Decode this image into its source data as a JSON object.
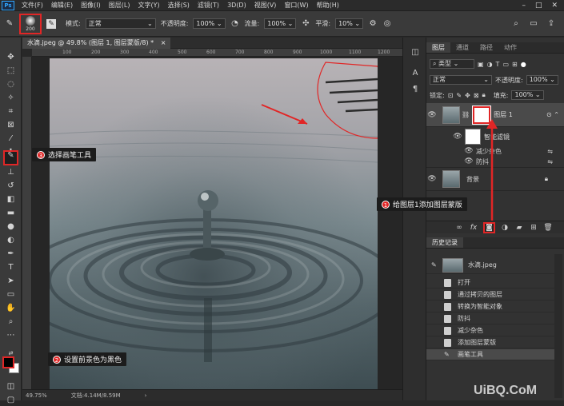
{
  "app": {
    "logo": "Ps",
    "menu": [
      "文件(F)",
      "编辑(E)",
      "图像(I)",
      "图层(L)",
      "文字(Y)",
      "选择(S)",
      "滤镜(T)",
      "3D(D)",
      "视图(V)",
      "窗口(W)",
      "帮助(H)"
    ],
    "window_controls": [
      "–",
      "□",
      "✕"
    ]
  },
  "options": {
    "brush_size": "200",
    "mode_label": "模式:",
    "mode_value": "正常",
    "opacity_label": "不透明度:",
    "opacity_value": "100%",
    "flow_label": "流量:",
    "flow_value": "100%",
    "smooth_label": "平滑:",
    "smooth_value": "10%"
  },
  "document": {
    "tab_title": "水滴.jpeg @ 49.8% (图层 1, 图层蒙版/8) *",
    "tab_close": "×",
    "ruler_ticks": [
      "100",
      "200",
      "300",
      "400",
      "500",
      "600",
      "700",
      "800",
      "900",
      "1000",
      "1100",
      "1200"
    ]
  },
  "status": {
    "zoom": "49.75%",
    "doc_size": "文档:4.14M/8.59M"
  },
  "layers_panel": {
    "tabs": [
      "图层",
      "通道",
      "路径",
      "动作"
    ],
    "filter_kind": "类型",
    "blend_mode": "正常",
    "opacity_label": "不透明度:",
    "opacity_value": "100%",
    "lock_label": "锁定:",
    "fill_label": "填充:",
    "fill_value": "100%",
    "layer1_name": "图层 1",
    "smart_filter_label": "智能滤镜",
    "filter1": "减少杂色",
    "filter2": "防抖",
    "background_name": "背景"
  },
  "history_panel": {
    "tab": "历史记录",
    "snapshot": "水滴.jpeg",
    "items": [
      "打开",
      "通过拷贝的图层",
      "转换为智能对象",
      "防抖",
      "减少杂色",
      "添加图层蒙版",
      "画笔工具"
    ]
  },
  "annotations": {
    "a1_num": "1",
    "a1_text": "给图层1添加图层蒙版",
    "a2_num": "2",
    "a2_text": "设置前景色为黑色",
    "a3_num": "3",
    "a3_text": "选择画笔工具"
  },
  "watermark": "UiBQ.CoM",
  "colors": {
    "highlight": "#e12626",
    "foreground": "#000000",
    "background": "#ffffff"
  }
}
